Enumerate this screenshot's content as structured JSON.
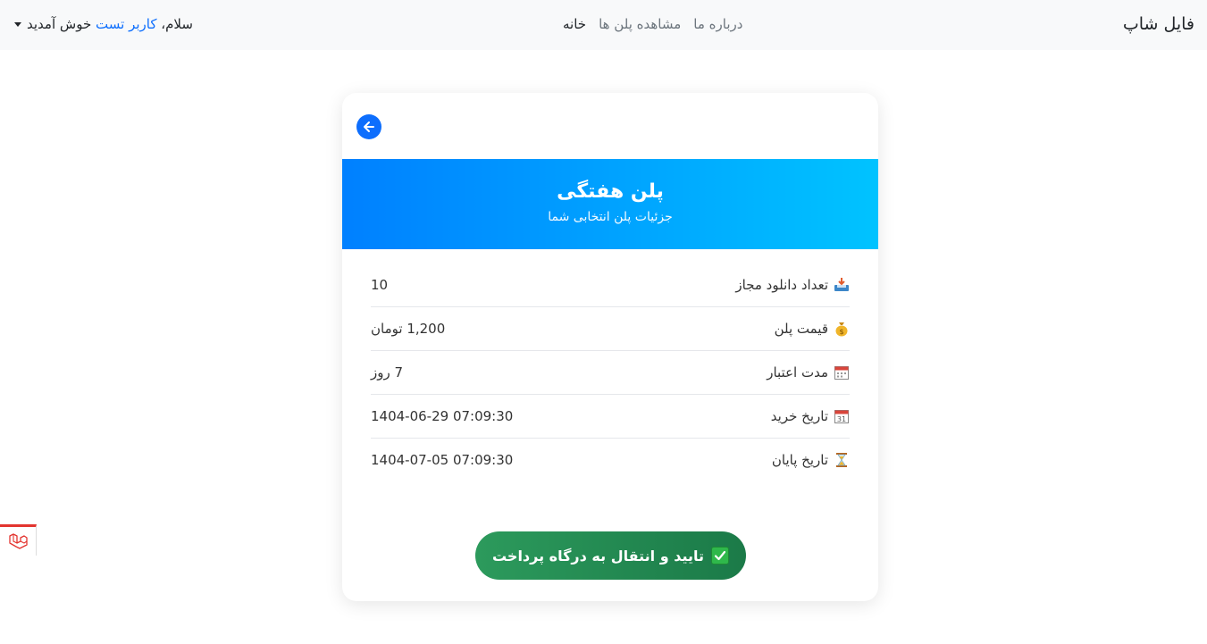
{
  "navbar": {
    "brand": "فایل شاپ",
    "links": [
      {
        "label": "خانه",
        "active": true
      },
      {
        "label": "مشاهده پلن ها",
        "active": false
      },
      {
        "label": "درباره ما",
        "active": false
      }
    ],
    "user_greeting_prefix": "سلام،",
    "user_name": "کاربر تست",
    "user_greeting_suffix": "خوش آمدید"
  },
  "card": {
    "back_icon": "arrow-left-icon",
    "title": "پلن هفتگی",
    "subtitle": "جزئیات پلن انتخابی شما",
    "details": [
      {
        "icon": "inbox-tray-icon",
        "label": "تعداد دانلود مجاز",
        "value": "10"
      },
      {
        "icon": "money-bag-icon",
        "label": "قیمت پلن",
        "value": "1,200 تومان"
      },
      {
        "icon": "calendar-icon",
        "label": "مدت اعتبار",
        "value": "7 روز"
      },
      {
        "icon": "calendar-date-icon",
        "label": "تاریخ خرید",
        "value": "1404-06-29 07:09:30"
      },
      {
        "icon": "hourglass-icon",
        "label": "تاریخ پایان",
        "value": "1404-07-05 07:09:30"
      }
    ],
    "pay_button": {
      "label": "تایید و انتقال به درگاه پرداخت",
      "icon": "check-mark-button-icon"
    }
  },
  "debug_tab": {
    "icon": "laravel-logo-icon"
  },
  "colors": {
    "navbar_bg": "#f8f9fa",
    "accent_blue": "#0d6efd",
    "header_gradient_start": "#0080ff",
    "header_gradient_end": "#00c3ff",
    "pay_button_green": "#1f8a50",
    "debug_red": "#e3342f"
  }
}
